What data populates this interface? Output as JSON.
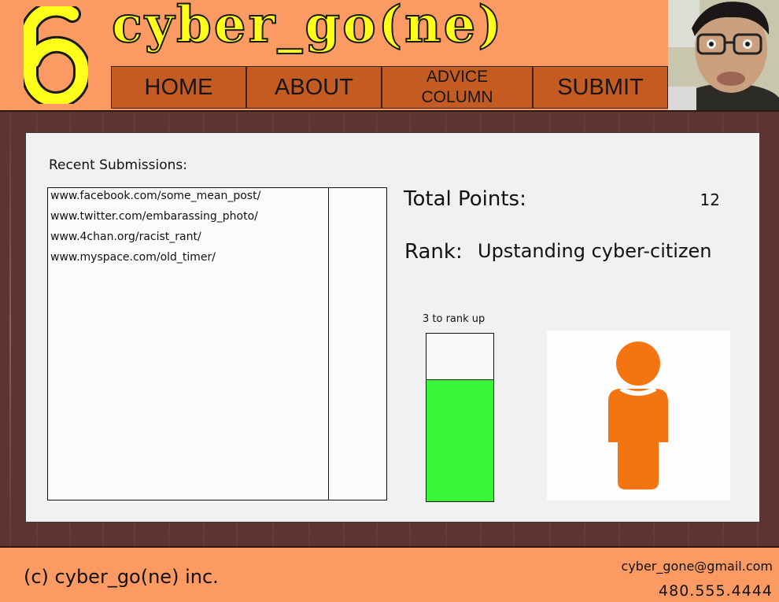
{
  "header": {
    "site_title": "cyber_go(ne)",
    "logo_icon": "six-icon",
    "nav": [
      {
        "label": "HOME"
      },
      {
        "label": "ABOUT"
      },
      {
        "label": "ADVICE\nCOLUMN"
      },
      {
        "label": "SUBMIT"
      }
    ]
  },
  "main": {
    "recent_label": "Recent Submissions:",
    "submissions": [
      "www.facebook.com/some_mean_post/",
      "www.twitter.com/embarassing_photo/",
      "www.4chan.org/racist_rant/",
      "www.myspace.com/old_timer/"
    ],
    "points_label": "Total Points:",
    "points_value": "12",
    "rank_label": "Rank:",
    "rank_value": "Upstanding cyber-citizen",
    "rankup_label": "3 to rank up",
    "progress_fraction": 0.73,
    "figure_icon": "person-icon"
  },
  "colors": {
    "header_bg": "#fc9a63",
    "nav_bg": "#c45b22",
    "title_fill": "#ffff1a",
    "progress_fill": "#3bf53b",
    "figure": "#f37411"
  },
  "footer": {
    "copyright": "(c) cyber_go(ne) inc.",
    "email": "cyber_gone@gmail.com",
    "phone": "480.555.4444"
  }
}
